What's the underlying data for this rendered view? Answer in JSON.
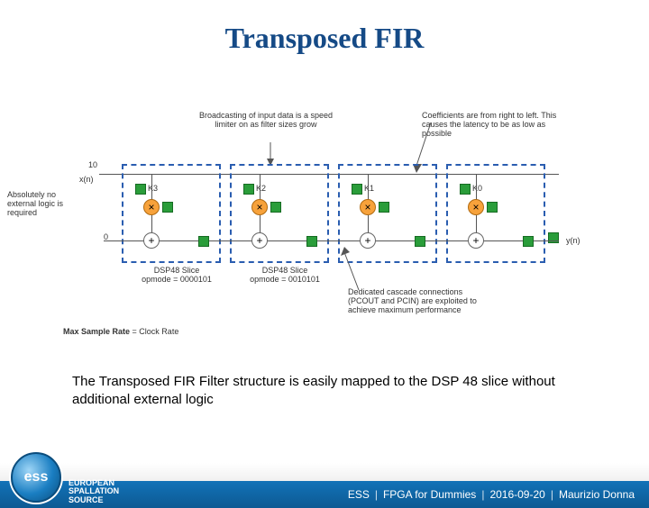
{
  "title": "Transposed FIR",
  "diagram": {
    "signal_in": "x(n)",
    "signal_out": "y(n)",
    "input_width": "10",
    "zero_left": "0",
    "taps": [
      {
        "coef": "K3"
      },
      {
        "coef": "K2"
      },
      {
        "coef": "K1"
      },
      {
        "coef": "K0"
      }
    ],
    "slice_labels": [
      {
        "line1": "DSP48 Slice",
        "line2": "opmode = 0000101"
      },
      {
        "line1": "DSP48 Slice",
        "line2": "opmode = 0010101"
      }
    ],
    "annotations": {
      "broadcast": "Broadcasting of input data is a speed limiter on as filter sizes grow",
      "coeffs": "Coefficients are from right to left. This causes the latency to be as low as possible",
      "noext": "Absolutely no external logic is required",
      "cascade": "Dedicated cascade connections (PCOUT and PCIN) are exploited to achieve maximum performance"
    },
    "max_rate_label_a": "Max Sample Rate",
    "max_rate_label_b": "= Clock Rate"
  },
  "caption": "The Transposed FIR Filter structure is easily mapped to the DSP 48 slice without additional external logic",
  "footer": {
    "org_short": "ESS",
    "org_lines": [
      "EUROPEAN",
      "SPALLATION",
      "SOURCE"
    ],
    "badge": "ess",
    "talk": "FPGA for Dummies",
    "date": "2016-09-20",
    "author": "Maurizio Donna"
  }
}
